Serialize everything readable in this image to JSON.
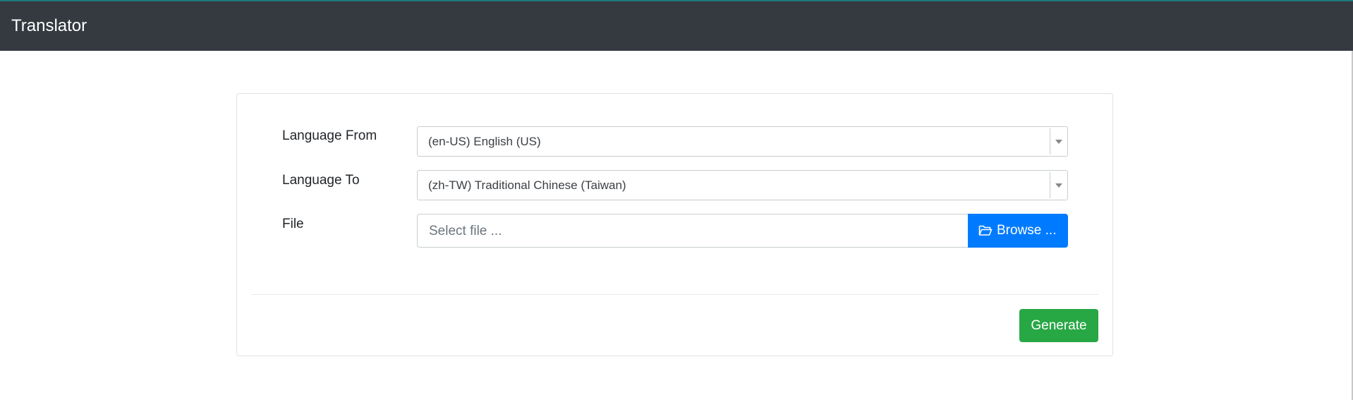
{
  "app": {
    "title": "Translator"
  },
  "form": {
    "language_from": {
      "label": "Language From",
      "value": "(en-US) English (US)"
    },
    "language_to": {
      "label": "Language To",
      "value": "(zh-TW) Traditional Chinese (Taiwan)"
    },
    "file": {
      "label": "File",
      "placeholder": "Select file ...",
      "browse_label": "Browse ..."
    },
    "generate_label": "Generate"
  },
  "colors": {
    "navbar": "#343a40",
    "primary": "#007bff",
    "success": "#28a745"
  },
  "icons": {
    "browse": "folder-open-icon",
    "dropdown": "caret-down-icon"
  }
}
